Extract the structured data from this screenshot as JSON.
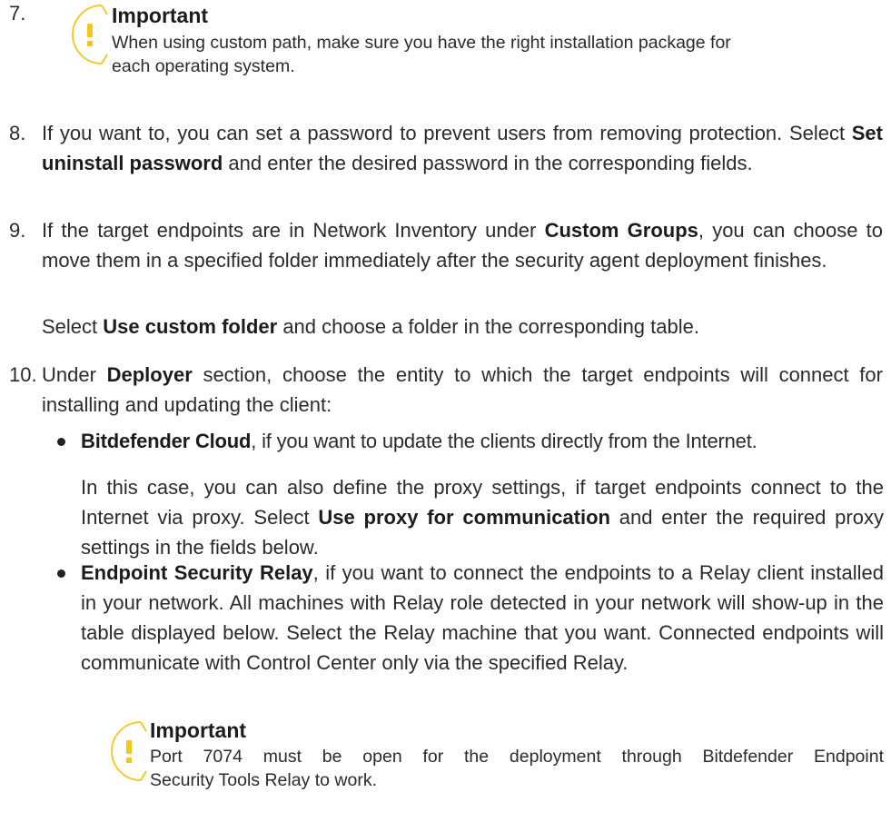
{
  "colors": {
    "warning_icon": "#F5C518",
    "text": "#2b2b2b"
  },
  "icons": {
    "warning": "warning-exclamation-icon",
    "bullet": "bullet-icon"
  },
  "note1": {
    "number": "7.",
    "title": "Important",
    "line1": "When using custom path, make sure you have the right installation package for",
    "line2": "each operating system."
  },
  "step8": {
    "number": "8.",
    "pre": "If you want to, you can set a password to prevent users from removing protection. Select ",
    "bold": "Set uninstall password",
    "post": " and enter the desired password in the corresponding fields."
  },
  "step9": {
    "number": "9.",
    "pre": "If the target endpoints are in Network Inventory under ",
    "bold": "Custom Groups",
    "post": ", you can choose to move them in a specified folder immediately after the security agent deployment finishes.",
    "sub_pre": "Select ",
    "sub_bold": "Use custom folder",
    "sub_post": " and choose a folder in the corresponding table."
  },
  "step10": {
    "number": "10.",
    "pre": "Under ",
    "bold": "Deployer",
    "post": " section, choose the entity to which the target endpoints will connect for installing and updating the client:"
  },
  "bullet1": {
    "bold": "Bitdefender Cloud",
    "text": ", if you want to update the clients directly from the Internet.",
    "sub_pre": "In this case, you can also define the proxy settings, if target endpoints connect to the Internet via proxy. Select ",
    "sub_bold": "Use proxy for communication",
    "sub_post": " and enter the required proxy settings in the fields below."
  },
  "bullet2": {
    "bold": "Endpoint Security Relay",
    "text": ", if you want to connect the endpoints to a Relay client installed in your network. All machines with Relay role detected in your network will show-up in the table displayed below. Select the Relay machine that you want. Connected endpoints will communicate with Control Center only via the specified Relay."
  },
  "note2": {
    "title": "Important",
    "line1": "Port 7074 must be open for the deployment through Bitdefender Endpoint",
    "line2": "Security Tools Relay to work."
  }
}
